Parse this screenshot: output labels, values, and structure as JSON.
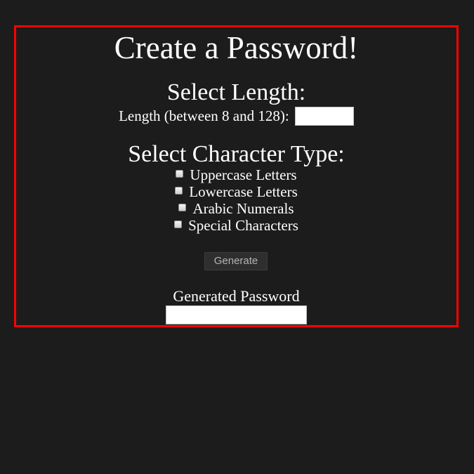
{
  "page": {
    "title": "Create a Password!",
    "border_color": "#ff0000",
    "background_color": "#1c1c1c"
  },
  "length_section": {
    "heading": "Select Length:",
    "label": "Length (between 8 and 128):",
    "value": "",
    "placeholder": ""
  },
  "type_section": {
    "heading": "Select Character Type:",
    "options": [
      {
        "label": "Uppercase Letters",
        "checked": false
      },
      {
        "label": "Lowercase Letters",
        "checked": false
      },
      {
        "label": "Arabic Numerals",
        "checked": false
      },
      {
        "label": "Special Characters",
        "checked": false
      }
    ]
  },
  "generate_button": {
    "label": "Generate"
  },
  "output": {
    "label": "Generated Password",
    "value": ""
  }
}
